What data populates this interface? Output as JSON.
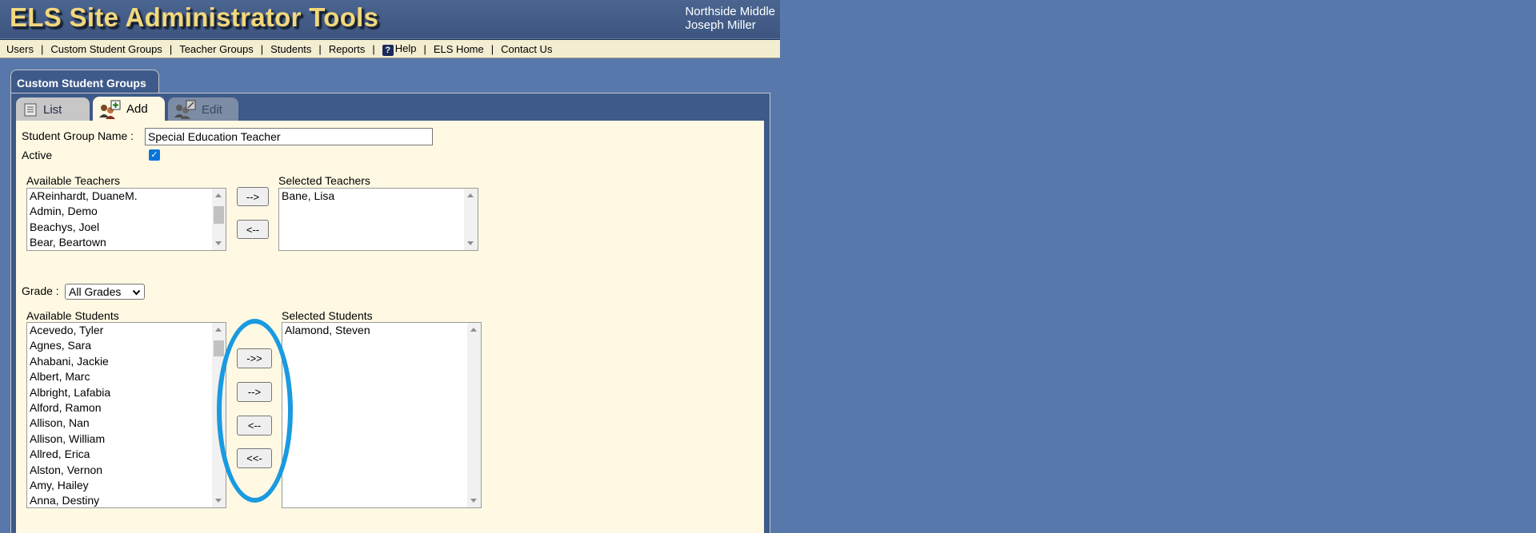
{
  "header": {
    "title": "ELS Site Administrator Tools",
    "school": "Northside Middle",
    "user": "Joseph Miller"
  },
  "nav": {
    "items": [
      "Users",
      "Custom Student Groups",
      "Teacher Groups",
      "Students",
      "Reports",
      "Help",
      "ELS Home",
      "Contact Us"
    ]
  },
  "panel": {
    "title": "Custom Student Groups",
    "tabs": {
      "list": "List",
      "add": "Add",
      "edit": "Edit"
    }
  },
  "form": {
    "group_name_label": "Student Group Name :",
    "group_name_value": "Special Education Teacher",
    "active_label": "Active",
    "active_checked": true,
    "available_teachers_label": "Available Teachers",
    "selected_teachers_label": "Selected Teachers",
    "available_teachers": [
      "AReinhardt, DuaneM.",
      "Admin, Demo",
      "Beachys, Joel",
      "Bear, Beartown"
    ],
    "selected_teachers": [
      "Bane, Lisa"
    ],
    "grade_label": "Grade :",
    "grade_value": "All Grades",
    "available_students_label": "Available Students",
    "selected_students_label": "Selected Students",
    "available_students": [
      "Acevedo, Tyler",
      "Agnes, Sara",
      "Ahabani, Jackie",
      "Albert, Marc",
      "Albright, Lafabia",
      "Alford, Ramon",
      "Allison, Nan",
      "Allison, William",
      "Allred, Erica",
      "Alston, Vernon",
      "Amy, Hailey",
      "Anna, Destiny"
    ],
    "selected_students": [
      "Alamond, Steven"
    ]
  },
  "buttons": {
    "add_teacher": "-->",
    "remove_teacher": "<--",
    "add_all_students": "->>",
    "add_student": "-->",
    "remove_student": "<--",
    "remove_all_students": "<<-"
  },
  "colors": {
    "background": "#5878ab",
    "title": "#f2d87c",
    "content": "#fff9e3",
    "annotation": "#1a9ae0"
  }
}
